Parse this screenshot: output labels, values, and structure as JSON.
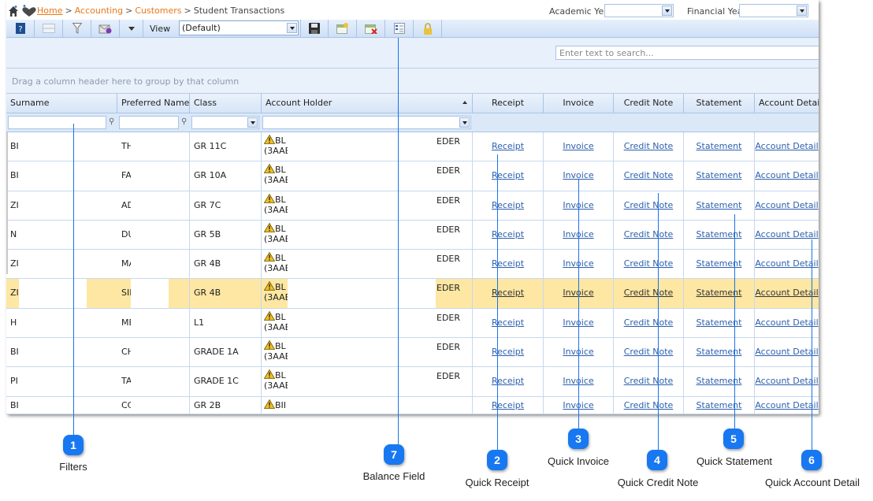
{
  "breadcrumb": {
    "items": [
      {
        "label": "Home",
        "link": true
      },
      {
        "label": "Accounting",
        "link": true
      },
      {
        "label": "Customers",
        "link": true
      },
      {
        "label": "Student Transactions",
        "link": false
      }
    ],
    "separator": ">"
  },
  "filters_top": {
    "academic_year_label": "Academic Year",
    "academic_year_value": "",
    "financial_year_label": "Financial Year",
    "financial_year_value": ""
  },
  "toolbar": {
    "buttons": [
      "help-icon",
      "layout-icon",
      "filter-icon",
      "email-icon",
      "dropdown-arrow-icon"
    ],
    "view_label": "View",
    "view_value": "(Default)",
    "right_buttons": [
      "save-icon",
      "new-view-icon",
      "delete-view-icon",
      "column-chooser-icon",
      "lock-icon"
    ]
  },
  "search": {
    "placeholder": "Enter text to search..."
  },
  "group_panel": {
    "text": "Drag a column header here to group by that column"
  },
  "columns": [
    "Surname",
    "Preferred Name",
    "Class",
    "Account Holder",
    "Receipt",
    "Invoice",
    "Credit Note",
    "Statement",
    "Account Detail"
  ],
  "rows": [
    {
      "surname": "BI",
      "preferred": "TH",
      "class": "GR 11C",
      "holder1": "BL",
      "holder2": "(3AAB",
      "balance": "EDER",
      "selected": false
    },
    {
      "surname": "BI",
      "preferred": "FA",
      "class": "GR 10A",
      "holder1": "BL",
      "holder2": "(3AAB",
      "balance": "EDER",
      "selected": false
    },
    {
      "surname": "ZI",
      "preferred": "AD",
      "class": "GR 7C",
      "holder1": "BL",
      "holder2": "(3AAB",
      "balance": "EDER",
      "selected": false
    },
    {
      "surname": "N",
      "preferred": "DU",
      "class": "GR 5B",
      "holder1": "BL",
      "holder2": "(3AAB",
      "balance": "EDER",
      "selected": false
    },
    {
      "surname": "ZI",
      "preferred": "MA",
      "class": "GR 4B",
      "holder1": "BL",
      "holder2": "(3AAB",
      "balance": "EDER",
      "selected": false
    },
    {
      "surname": "ZI",
      "preferred": "SII",
      "class": "GR 4B",
      "holder1": "BL",
      "holder2": "(3AAB",
      "balance": "EDER",
      "selected": true
    },
    {
      "surname": "H",
      "preferred": "ME",
      "class": "L1",
      "holder1": "BL",
      "holder2": "(3AAB",
      "balance": "EDER",
      "selected": false
    },
    {
      "surname": "BI",
      "preferred": "CH",
      "class": "GRADE 1A",
      "holder1": "BL",
      "holder2": "(3AAB",
      "balance": "EDER",
      "selected": false
    },
    {
      "surname": "PI",
      "preferred": "TA",
      "class": "GRADE 1C",
      "holder1": "BL",
      "holder2": "(3AAB",
      "balance": "EDER",
      "selected": false
    },
    {
      "surname": "BI",
      "preferred": "CC",
      "class": "GR 2B",
      "holder1": "BII",
      "holder2": "",
      "balance": "",
      "selected": false
    }
  ],
  "row_links": {
    "receipt": "Receipt",
    "invoice": "Invoice",
    "credit_note": "Credit Note",
    "statement": "Statement",
    "account_detail": "Account Detail"
  },
  "callouts": [
    {
      "number": "1",
      "label": "Filters"
    },
    {
      "number": "2",
      "label": "Quick Receipt"
    },
    {
      "number": "3",
      "label": "Quick Invoice"
    },
    {
      "number": "4",
      "label": "Quick Credit Note"
    },
    {
      "number": "5",
      "label": "Quick Statement"
    },
    {
      "number": "6",
      "label": "Quick Account Detail"
    },
    {
      "number": "7",
      "label": "Balance Field"
    }
  ],
  "colors": {
    "accent": "#1778f2",
    "link": "#2c60ad",
    "breadcrumb_link": "#e77817",
    "selected_row": "#fde7a3"
  }
}
